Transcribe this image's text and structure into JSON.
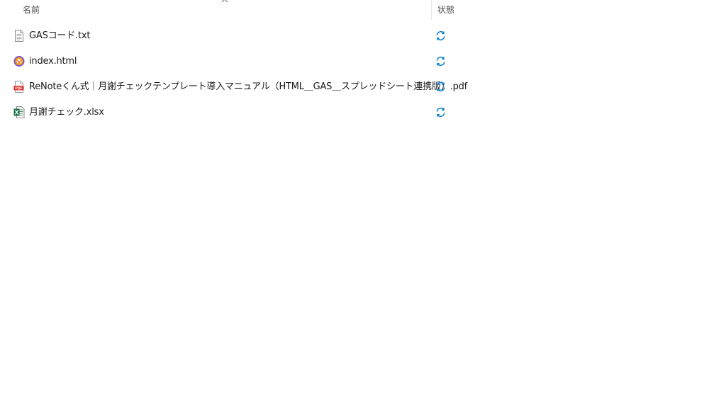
{
  "columns": {
    "name": "名前",
    "status": "状態"
  },
  "files": [
    {
      "name": "GASコード.txt",
      "icon": "text-file-icon",
      "status_icon": "sync-icon"
    },
    {
      "name": "index.html",
      "icon": "html-file-icon",
      "status_icon": "sync-icon"
    },
    {
      "name": "ReNoteくん式｜月謝チェックテンプレート導入マニュアル（HTML＿GAS＿スプレッドシート連携版）.pdf",
      "icon": "pdf-file-icon",
      "status_icon": "sync-icon"
    },
    {
      "name": "月謝チェック.xlsx",
      "icon": "excel-file-icon",
      "status_icon": "sync-icon"
    }
  ],
  "colors": {
    "sync": "#0a7fd1",
    "pdf": "#d93025",
    "excel": "#1d6f42",
    "html_browser_outer": "#7b4fd6",
    "html_browser_inner": "#f59e0b"
  }
}
